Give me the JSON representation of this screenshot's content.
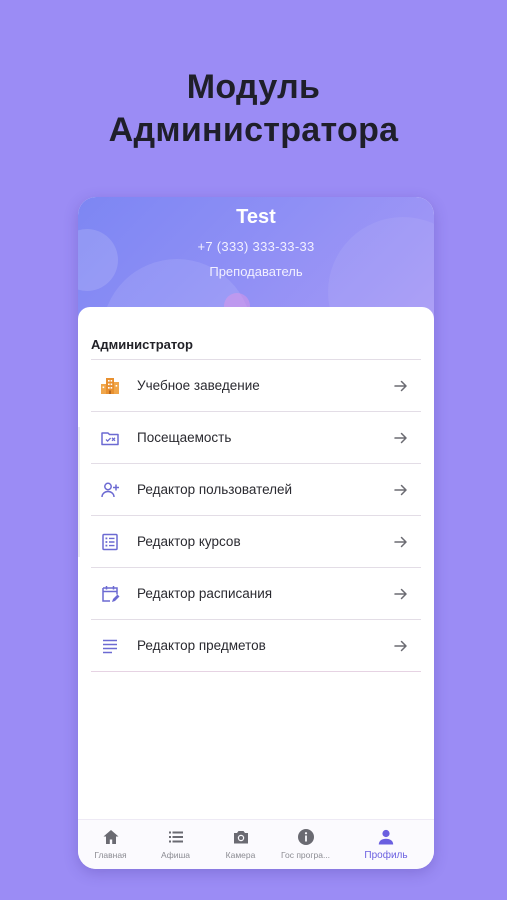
{
  "promo": {
    "line1": "Модуль",
    "line2": "Администратора"
  },
  "profile": {
    "name": "Test",
    "phone": "+7 (333) 333-33-33",
    "role": "Преподаватель"
  },
  "admin": {
    "section_title": "Администратор",
    "items": [
      {
        "label": "Учебное заведение",
        "icon": "building-icon"
      },
      {
        "label": "Посещаемость",
        "icon": "attendance-folder-icon"
      },
      {
        "label": "Редактор пользователей",
        "icon": "add-user-icon"
      },
      {
        "label": "Редактор курсов",
        "icon": "list-icon"
      },
      {
        "label": "Редактор расписания",
        "icon": "calendar-edit-icon"
      },
      {
        "label": "Редактор предметов",
        "icon": "subject-lines-icon"
      }
    ]
  },
  "bottom_nav": {
    "items": [
      {
        "label": "Главная",
        "icon": "home-icon"
      },
      {
        "label": "Афиша",
        "icon": "poster-list-icon"
      },
      {
        "label": "Камера",
        "icon": "camera-icon"
      },
      {
        "label": "Гос програ...",
        "icon": "info-icon"
      },
      {
        "label": "Профиль",
        "icon": "profile-icon",
        "active": true
      }
    ]
  },
  "colors": {
    "background": "#9b8cf5",
    "accent": "#6a5fe0",
    "icon_purple": "#6c6ad2",
    "building_orange": "#e8902f"
  }
}
